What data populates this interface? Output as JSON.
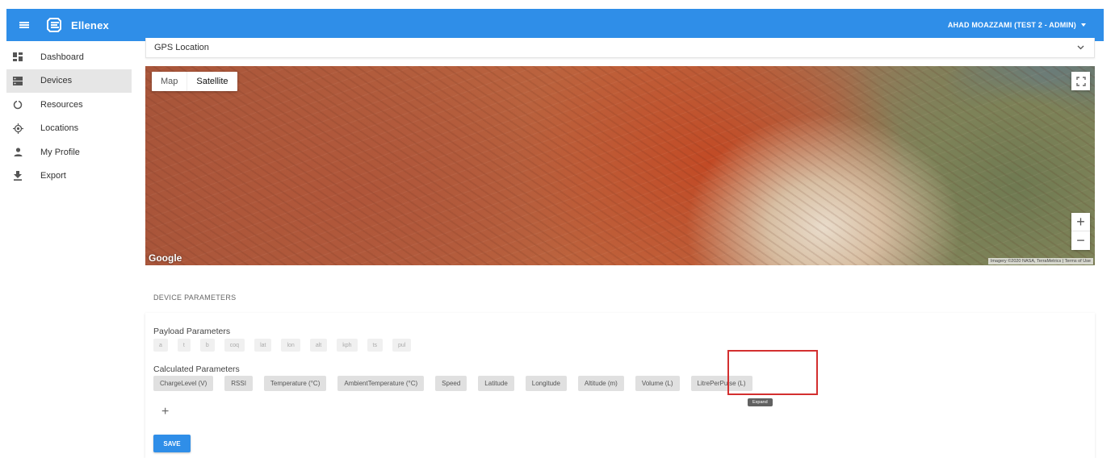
{
  "app": {
    "title": "Ellenex",
    "user": "AHAD MOAZZAMI (TEST 2 - ADMIN)"
  },
  "sidebar": {
    "items": [
      {
        "label": "Dashboard",
        "icon": "dashboard-icon",
        "active": false
      },
      {
        "label": "Devices",
        "icon": "devices-icon",
        "active": true
      },
      {
        "label": "Resources",
        "icon": "resources-icon",
        "active": false
      },
      {
        "label": "Locations",
        "icon": "location-icon",
        "active": false
      },
      {
        "label": "My Profile",
        "icon": "person-icon",
        "active": false
      },
      {
        "label": "Export",
        "icon": "download-icon",
        "active": false
      }
    ]
  },
  "gps": {
    "label": "GPS Location"
  },
  "map": {
    "tabs": {
      "map": "Map",
      "satellite": "Satellite"
    },
    "zoom_in": "+",
    "zoom_out": "−",
    "provider": "Google",
    "attribution": "Imagery ©2020 NASA, TerraMetrics | Terms of Use"
  },
  "device_parameters": {
    "title": "DEVICE PARAMETERS",
    "payload_label": "Payload Parameters",
    "payload": [
      "a",
      "t",
      "b",
      "coq",
      "lat",
      "lon",
      "alt",
      "kph",
      "ts",
      "pul"
    ],
    "calculated_label": "Calculated Parameters",
    "calculated": [
      "ChargeLevel (V)",
      "RSSI",
      "Temperature (°C)",
      "AmbientTemperature (°C)",
      "Speed",
      "Latitude",
      "Longitude",
      "Altitude (m)",
      "Volume (L)",
      "LitrePerPulse (L)"
    ],
    "tooltip": "Expand",
    "add": "+",
    "save": "SAVE"
  },
  "colors": {
    "primary": "#2f8ee8",
    "highlight": "#d32f2f"
  }
}
